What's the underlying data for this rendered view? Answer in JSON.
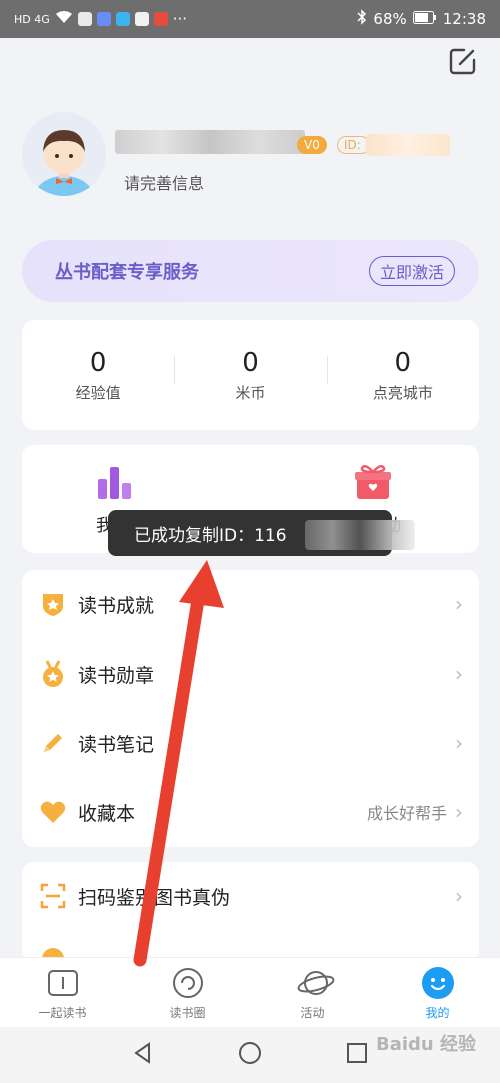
{
  "status_bar": {
    "left_text": "HD 4G",
    "dots": "···",
    "battery": "68%",
    "time": "12:38"
  },
  "profile": {
    "level_badge": "V0",
    "id_badge": "ID:",
    "subtitle": "请完善信息"
  },
  "service_banner": {
    "title": "丛书配套专享服务",
    "button": "立即激活"
  },
  "stats": [
    {
      "value": "0",
      "label": "经验值"
    },
    {
      "value": "0",
      "label": "米币"
    },
    {
      "value": "0",
      "label": "点亮城市"
    }
  ],
  "shortcuts": [
    {
      "label": "我",
      "icon": "bar-chart-icon"
    },
    {
      "label": "动",
      "icon": "gift-icon"
    }
  ],
  "toast": {
    "text": "已成功复制ID：116"
  },
  "menu": [
    {
      "label": "读书成就",
      "extra": "",
      "icon": "achievement-shield-icon"
    },
    {
      "label": "读书勋章",
      "extra": "",
      "icon": "medal-icon"
    },
    {
      "label": "读书笔记",
      "extra": "",
      "icon": "pencil-icon"
    },
    {
      "label": "收藏本",
      "extra": "成长好帮手",
      "icon": "heart-icon"
    }
  ],
  "menu2": [
    {
      "label": "扫码鉴别图书真伪",
      "icon": "scan-icon"
    }
  ],
  "tabs": [
    {
      "label": "一起读书",
      "icon": "book-icon",
      "active": false
    },
    {
      "label": "读书圈",
      "icon": "circle-icon",
      "active": false
    },
    {
      "label": "活动",
      "icon": "planet-icon",
      "active": false
    },
    {
      "label": "我的",
      "icon": "smiley-icon",
      "active": true
    }
  ],
  "watermark": "Baidu 经验",
  "colors": {
    "accent_purple": "#6a5ec8",
    "accent_blue": "#1c9cf2",
    "orange": "#f3a93b",
    "arrow_red": "#e8402f"
  }
}
